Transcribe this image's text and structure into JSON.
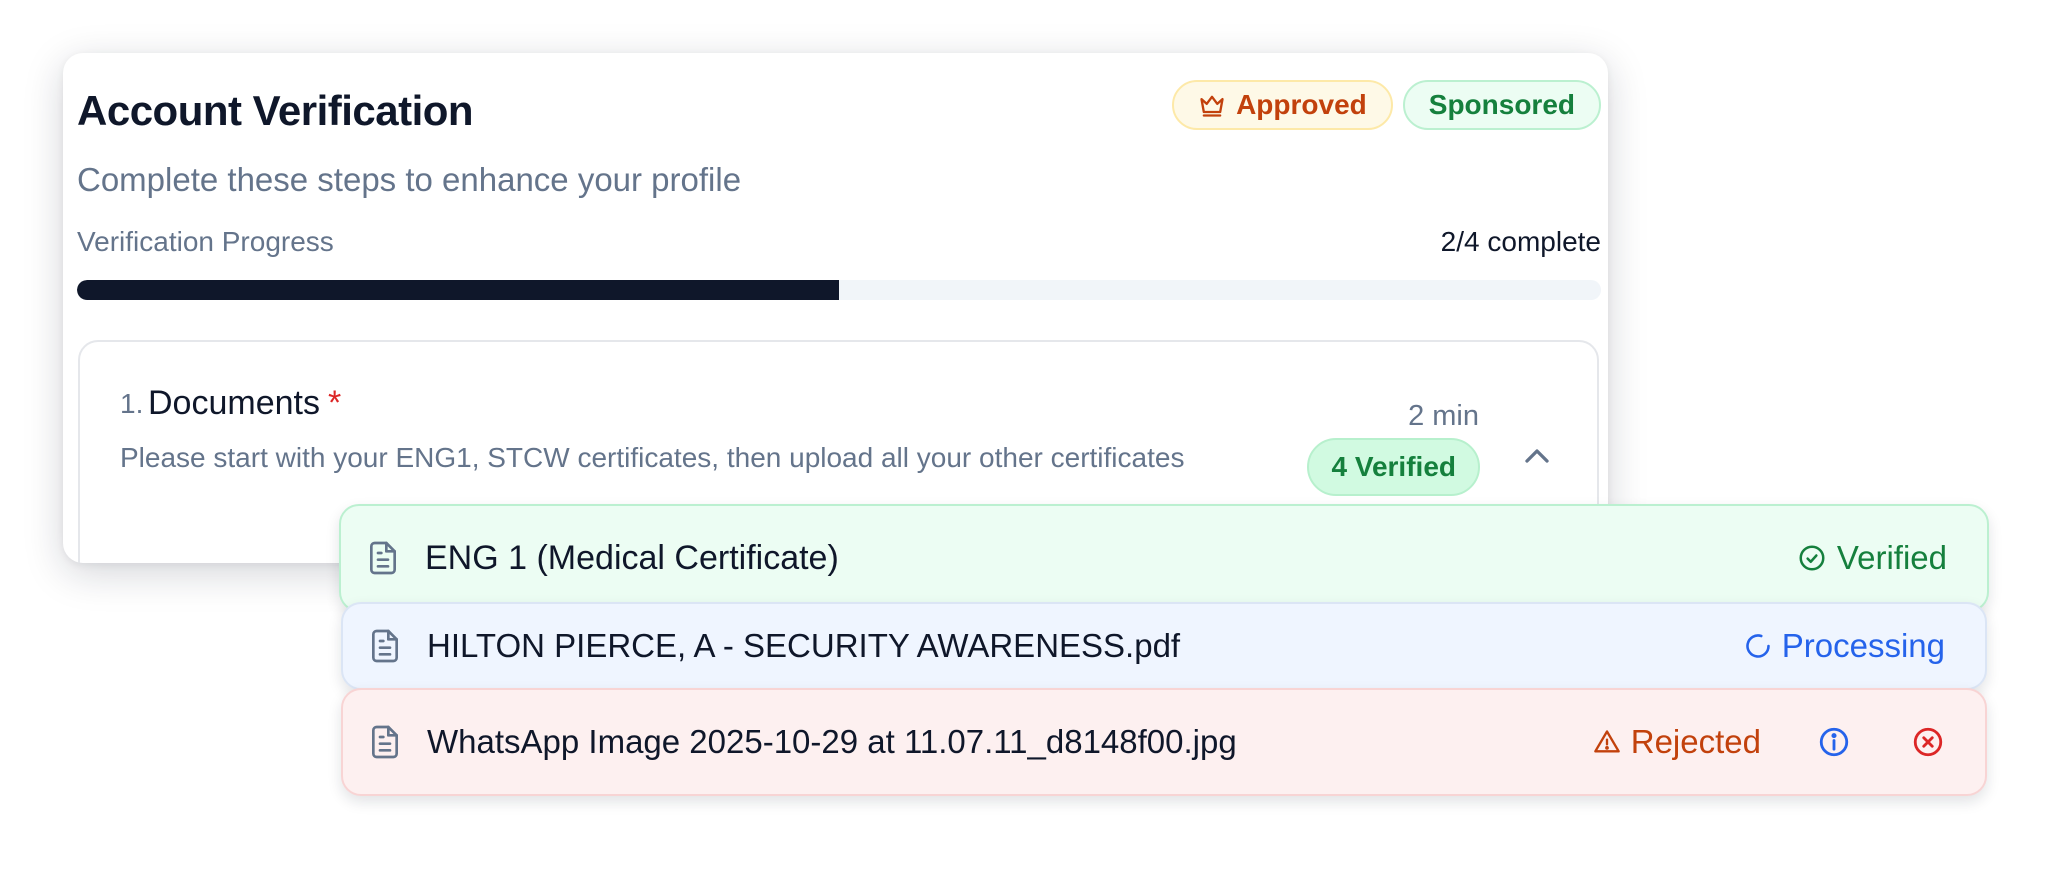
{
  "card": {
    "title": "Account Verification",
    "subtitle": "Complete these steps to enhance your profile",
    "badges": [
      {
        "label": "Approved",
        "icon": "crown-icon",
        "color": "#c2410c"
      },
      {
        "label": "Sponsored",
        "color": "#15803d"
      }
    ],
    "progress": {
      "label": "Verification Progress",
      "count_text": "2/4 complete",
      "fill_fraction": 0.5
    },
    "step": {
      "number": "1.",
      "title": "Documents",
      "required_mark": "*",
      "description": "Please start with your ENG1, STCW certificates, then upload all your other certificates",
      "time": "2 min",
      "verified_badge": "4 Verified",
      "chevron_icon": "chevron-up-icon"
    }
  },
  "files": [
    {
      "name": "ENG 1 (Medical Certificate)",
      "icon": "document-icon",
      "status": "Verified",
      "status_icon": "check-circle-icon",
      "status_color": "#15803d"
    },
    {
      "name": "HILTON PIERCE, A - SECURITY AWARENESS.pdf",
      "icon": "document-icon",
      "status": "Processing",
      "status_icon": "spinner-icon",
      "status_color": "#2563eb"
    },
    {
      "name": "WhatsApp Image 2025-10-29 at 11.07.11_d8148f00.jpg",
      "icon": "document-icon",
      "status": "Rejected",
      "status_icon": "warning-icon",
      "status_color": "#c2410c",
      "actions": [
        "info-icon",
        "close-circle-icon"
      ]
    }
  ]
}
